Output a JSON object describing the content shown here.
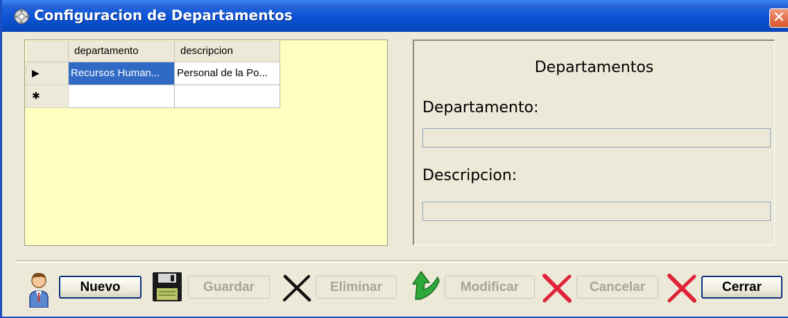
{
  "window": {
    "title": "Configuracion de Departamentos",
    "close_label": "✕"
  },
  "grid": {
    "columns": [
      "departamento",
      "descripcion"
    ],
    "rows": [
      {
        "marker": "▶",
        "departamento": "Recursos Human...",
        "descripcion": "Personal de la Po..."
      },
      {
        "marker": "✱",
        "departamento": "",
        "descripcion": ""
      }
    ]
  },
  "detail": {
    "heading": "Departamentos",
    "departamento_label": "Departamento:",
    "departamento_value": "",
    "descripcion_label": "Descripcion:",
    "descripcion_value": ""
  },
  "toolbar": {
    "nuevo": "Nuevo",
    "guardar": "Guardar",
    "eliminar": "Eliminar",
    "modificar": "Modificar",
    "cancelar": "Cancelar",
    "cerrar": "Cerrar"
  },
  "icons": {
    "window": "gear-icon",
    "nuevo": "user-icon",
    "guardar": "floppy-disk-icon",
    "eliminar": "x-mark-icon",
    "modificar": "green-arrow-icon",
    "cancelar": "red-x-icon",
    "cerrar": "red-x-icon"
  },
  "colors": {
    "titlebar": "#0a53d6",
    "grid_background": "#ffffc0",
    "selection": "#316ac5",
    "window_face": "#ece9d8",
    "red_x": "#e0233a",
    "green_arrow": "#2fa83a"
  }
}
